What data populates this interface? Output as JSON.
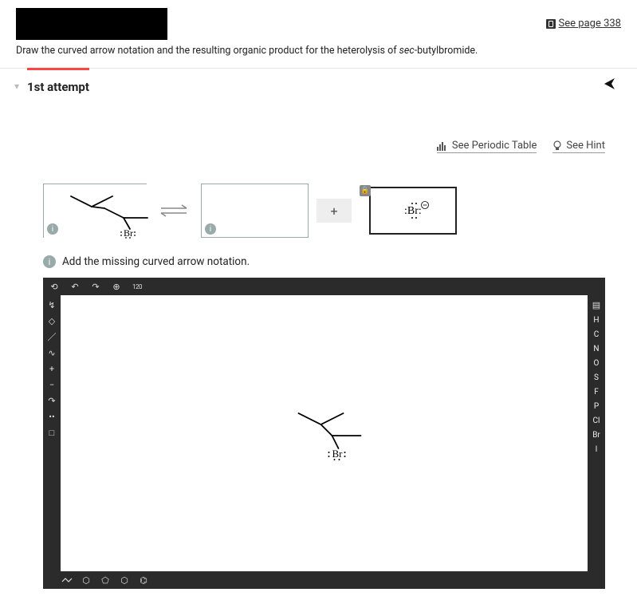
{
  "header": {
    "page_ref_label": "See page 338",
    "prompt_pre": "Draw the curved arrow notation and the resulting organic product for the heterolysis of ",
    "prompt_italic": "sec",
    "prompt_post": "-butylbromide."
  },
  "attempt": {
    "title": "1st attempt"
  },
  "links": {
    "periodic": "See Periodic Table",
    "hint": "See Hint"
  },
  "boxes": {
    "reactant_atom": "Br",
    "product_ion_label": ":Br:",
    "plus": "+"
  },
  "instruction": "Add the missing curved arrow notation.",
  "editor": {
    "top_tools": [
      "refresh",
      "undo",
      "redo",
      "zoom",
      "120"
    ],
    "left_tools": [
      "select",
      "erase",
      "bond",
      "wavy",
      "charge-plus",
      "charge-minus",
      "arrow",
      "lone-pair",
      "marquee"
    ],
    "right_elements": [
      "H",
      "C",
      "N",
      "O",
      "S",
      "F",
      "P",
      "Cl",
      "Br",
      "I"
    ],
    "bottom_tools": [
      "ring3",
      "ring4",
      "ring5",
      "ring6",
      "benzene"
    ],
    "canvas_atom": "Br"
  },
  "icons": {
    "chevron_down": "▾",
    "send": "✦",
    "info": "i",
    "lock": "🔒",
    "periodic": "⎍",
    "hint_bulb": "◎",
    "refresh": "⟲",
    "undo": "↶",
    "redo": "↷",
    "zoom": "⊕",
    "select": "↯",
    "erase": "◇",
    "bond": "／",
    "wavy": "∿",
    "plus": "+",
    "minus": "−",
    "arrow": "↷",
    "dots": "••",
    "marquee": "□",
    "ring3": "△",
    "ring4": "◇",
    "ring5": "⬠",
    "ring6": "⬡",
    "benzene": "⌬",
    "panel": "▤"
  }
}
